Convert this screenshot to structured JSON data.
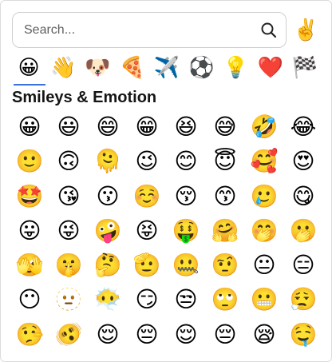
{
  "search": {
    "placeholder": "Search...",
    "value": ""
  },
  "skin_tone_button": {
    "glyph": "✌️"
  },
  "tabs": [
    {
      "name": "smileys",
      "glyph": "😀",
      "active": true
    },
    {
      "name": "people",
      "glyph": "👋"
    },
    {
      "name": "animals",
      "glyph": "🐶"
    },
    {
      "name": "food",
      "glyph": "🍕"
    },
    {
      "name": "travel",
      "glyph": "✈️"
    },
    {
      "name": "activities",
      "glyph": "⚽"
    },
    {
      "name": "objects",
      "glyph": "💡"
    },
    {
      "name": "symbols",
      "glyph": "❤️"
    },
    {
      "name": "flags",
      "glyph": "🏁"
    }
  ],
  "section": {
    "title": "Smileys & Emotion"
  },
  "emojis": [
    "😀",
    "😃",
    "😄",
    "😁",
    "😆",
    "😅",
    "🤣",
    "😂",
    "🙂",
    "🙃",
    "🫠",
    "😉",
    "😊",
    "😇",
    "🥰",
    "😍",
    "🤩",
    "😘",
    "😗",
    "☺️",
    "😚",
    "😙",
    "🥲",
    "😋",
    "😛",
    "😜",
    "🤪",
    "😝",
    "🤑",
    "🤗",
    "🤭",
    "🫢",
    "🫣",
    "🤫",
    "🤔",
    "🫡",
    "🤐",
    "🤨",
    "😐",
    "😑",
    "😶",
    "🫥",
    "😶‍🌫️",
    "😏",
    "😒",
    "🙄",
    "😬",
    "😮‍💨",
    "🤥",
    "🫨",
    "😌",
    "😔",
    "😌",
    "😔",
    "😪",
    "🤤"
  ],
  "accent_color": "#3a73d8"
}
